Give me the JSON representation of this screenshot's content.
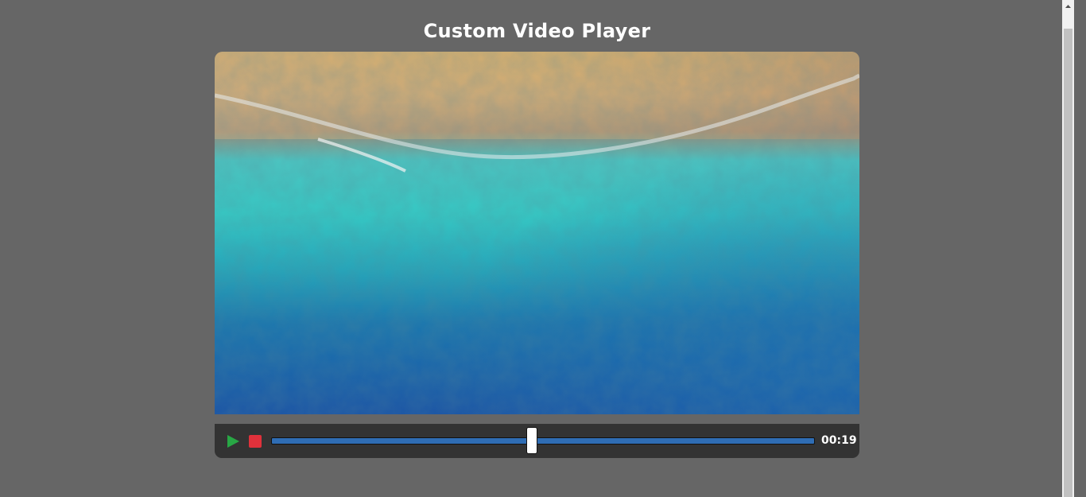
{
  "page": {
    "title": "Custom Video Player"
  },
  "player": {
    "video": {
      "description_icon": "video-frame"
    },
    "controls": {
      "play_icon": "play-icon",
      "stop_icon": "stop-icon",
      "progress_fraction": 0.48,
      "time_display": "00:19"
    },
    "colors": {
      "play": "#28a745",
      "stop": "#e0313b",
      "progress": "#2f6db4"
    }
  }
}
